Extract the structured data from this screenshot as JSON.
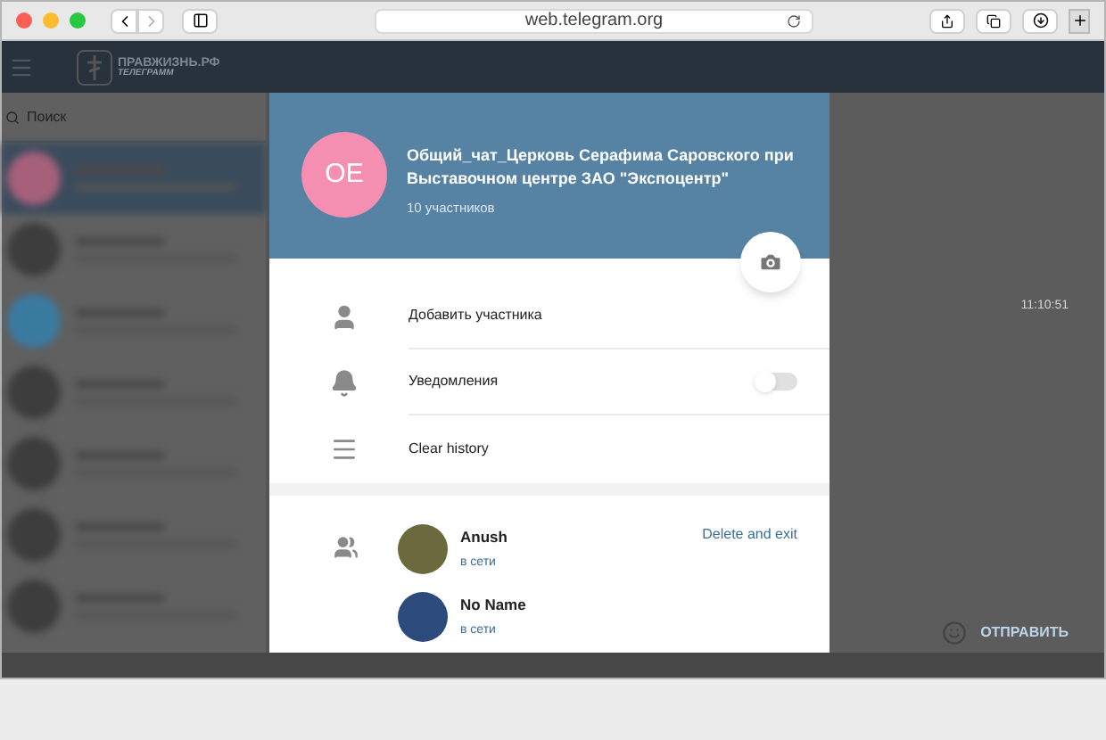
{
  "browser": {
    "url": "web.telegram.org"
  },
  "app_header": {
    "logo_title": "ПРАВЖИЗНЬ.РФ",
    "logo_subtitle": "ТЕЛЕГРАММ"
  },
  "sidebar": {
    "search_placeholder": "Поиск"
  },
  "chat": {
    "time": "11:10:51",
    "send_label": "ОТПРАВИТЬ"
  },
  "modal": {
    "avatar_initials": "OE",
    "title": "Общий_чат_Церковь Серафима Саровского при Выставочном центре ЗАО \"Экспоцентр\"",
    "members_count": "10 участников",
    "actions": [
      {
        "kind": "button",
        "label": "Добавить участника"
      },
      {
        "kind": "toggle",
        "label": "Уведомления",
        "on": false
      },
      {
        "kind": "button",
        "label": "Clear history"
      }
    ],
    "members": [
      {
        "name": "Anush",
        "status": "в сети"
      },
      {
        "name": "No Name",
        "status": "в сети"
      }
    ],
    "delete_exit": "Delete and exit"
  }
}
